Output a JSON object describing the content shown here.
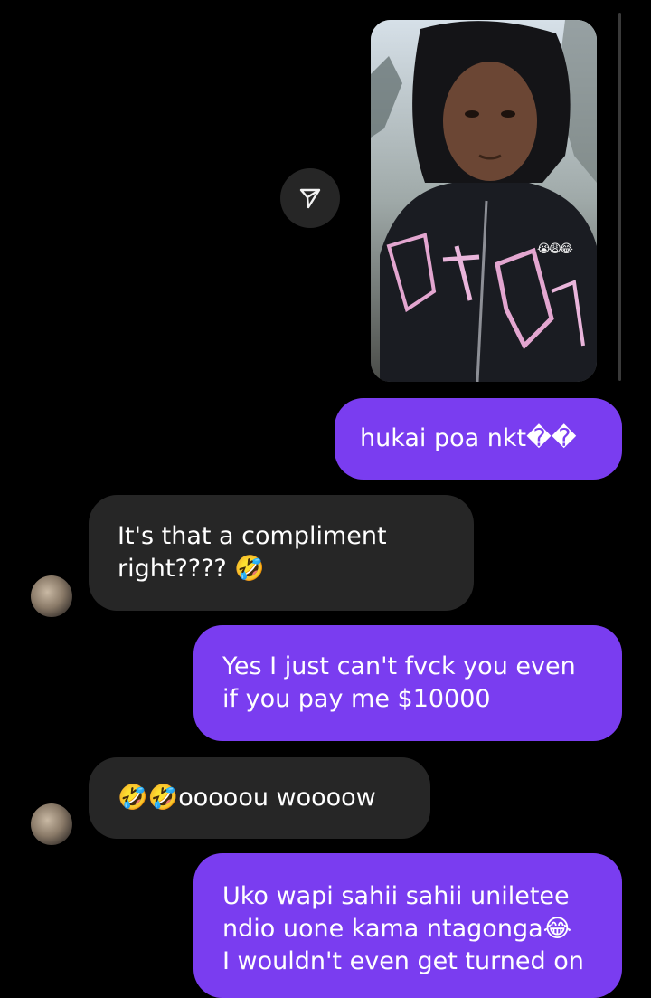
{
  "thread": {
    "shared_photo": {
      "caption_emoji": "😭😩😂"
    },
    "messages": [
      {
        "side": "sent",
        "lines": [
          "hukai poa nkt�� "
        ]
      },
      {
        "side": "received",
        "lines": [
          "It's that a compliment",
          "right???? 🤣"
        ]
      },
      {
        "side": "sent",
        "lines": [
          "Yes I just can't fvck you even",
          "if you pay me $10000"
        ]
      },
      {
        "side": "received",
        "lines": [
          "🤣🤣oooοοu wooοοw"
        ]
      },
      {
        "side": "sent",
        "lines": [
          "Uko wapi sahii sahii uniletee",
          "ndio uone kama ntagonga😂",
          "I wouldn't even get turned on"
        ]
      }
    ]
  },
  "icons": {
    "share": "send-icon",
    "avatar": "contact-avatar"
  },
  "colors": {
    "background": "#000000",
    "sent_bubble": "#7a3df0",
    "received_bubble": "#262626",
    "text": "#ffffff"
  }
}
